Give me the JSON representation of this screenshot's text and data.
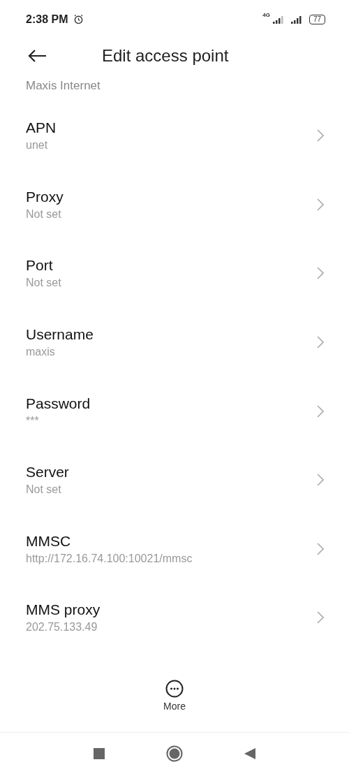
{
  "status_bar": {
    "time": "2:38 PM",
    "network": "4G",
    "battery": "77"
  },
  "header": {
    "title": "Edit access point"
  },
  "subtitle": "Maxis Internet",
  "rows": [
    {
      "label": "APN",
      "value": "unet"
    },
    {
      "label": "Proxy",
      "value": "Not set"
    },
    {
      "label": "Port",
      "value": "Not set"
    },
    {
      "label": "Username",
      "value": "maxis"
    },
    {
      "label": "Password",
      "value": "***"
    },
    {
      "label": "Server",
      "value": "Not set"
    },
    {
      "label": "MMSC",
      "value": "http://172.16.74.100:10021/mmsc"
    },
    {
      "label": "MMS proxy",
      "value": "202.75.133.49"
    }
  ],
  "more": {
    "label": "More"
  }
}
